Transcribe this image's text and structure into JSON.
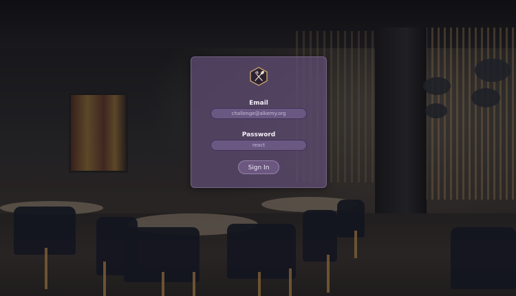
{
  "background": {
    "description_icon": "restaurant-background"
  },
  "login": {
    "logo_icon": "utensils-hexagon-icon",
    "email_label": "Email",
    "email_value": "challenge@alkemy.org",
    "password_label": "Password",
    "password_value": "react",
    "submit_label": "Sign In"
  },
  "colors": {
    "card": "#5c4a70",
    "field": "#6a5883",
    "logo_hex": "#c9a46a"
  }
}
